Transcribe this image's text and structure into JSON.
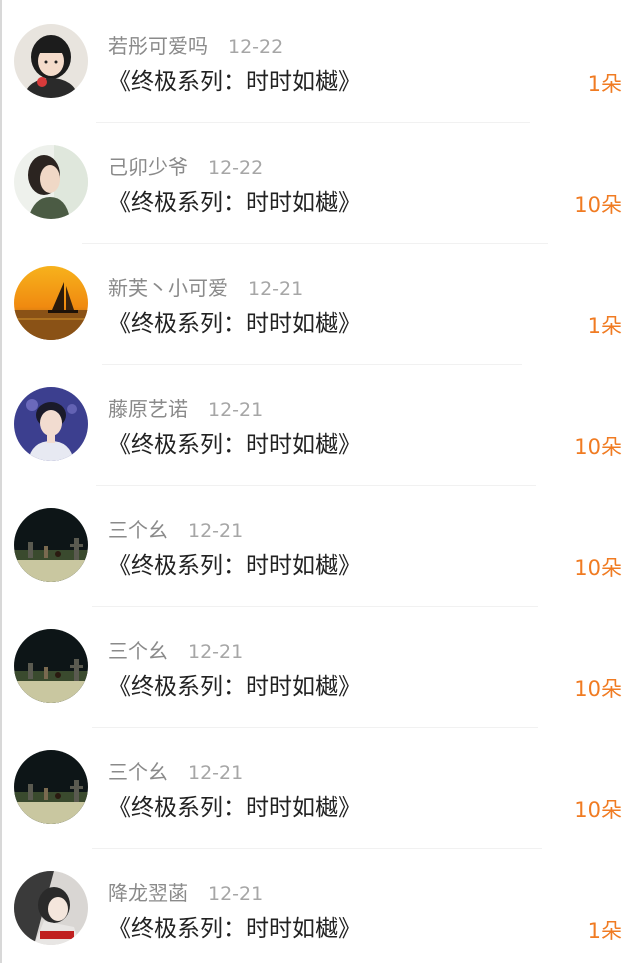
{
  "accent_color": "#f07b22",
  "items": [
    {
      "name": "若彤可爱吗",
      "date": "12-22",
      "title": "《终极系列：时时如樾》",
      "gift": "1朵",
      "avatar": "girl-portrait-icon"
    },
    {
      "name": "己卯少爷",
      "date": "12-22",
      "title": "《终极系列：时时如樾》",
      "gift": "10朵",
      "avatar": "woman-profile-icon"
    },
    {
      "name": "新芙丶小可爱",
      "date": "12-21",
      "title": "《终极系列：时时如樾》",
      "gift": "1朵",
      "avatar": "sunset-sailboat-icon"
    },
    {
      "name": "藤原艺诺",
      "date": "12-21",
      "title": "《终极系列：时时如樾》",
      "gift": "10朵",
      "avatar": "young-man-portrait-icon"
    },
    {
      "name": "三个幺",
      "date": "12-21",
      "title": "《终极系列：时时如樾》",
      "gift": "10朵",
      "avatar": "dark-field-scene-icon"
    },
    {
      "name": "三个幺",
      "date": "12-21",
      "title": "《终极系列：时时如樾》",
      "gift": "10朵",
      "avatar": "dark-field-scene-icon"
    },
    {
      "name": "三个幺",
      "date": "12-21",
      "title": "《终极系列：时时如樾》",
      "gift": "10朵",
      "avatar": "dark-field-scene-icon"
    },
    {
      "name": "降龙翌菡",
      "date": "12-21",
      "title": "《终极系列：时时如樾》",
      "gift": "1朵",
      "avatar": "anime-character-icon"
    }
  ]
}
